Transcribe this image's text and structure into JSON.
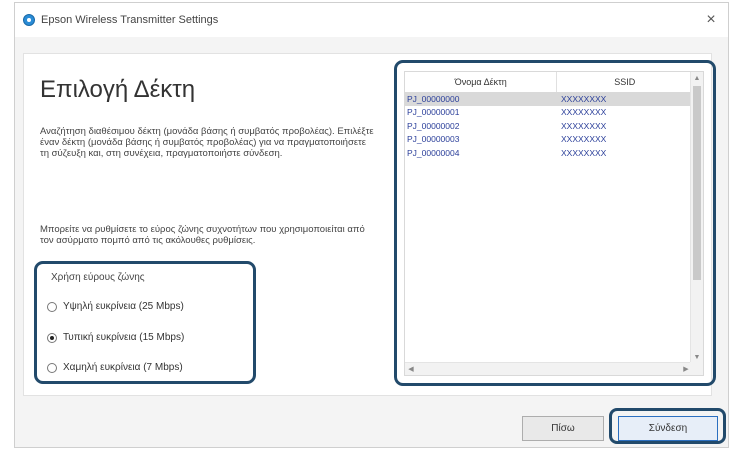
{
  "window": {
    "title": "Epson Wireless Transmitter Settings",
    "close_glyph": "×",
    "app_icon": "epson-app-icon"
  },
  "main": {
    "heading": "Επιλογή Δέκτη",
    "description_1": "Αναζήτηση διαθέσιμου δέκτη (μονάδα βάσης ή συμβατός προβολέας). Επιλέξτε έναν δέκτη (μονάδα βάσης ή συμβατός προβολέας) για να πραγματοποιήσετε τη σύζευξη και, στη συνέχεια, πραγματοποιήστε σύνδεση.",
    "description_2": "Μπορείτε να ρυθμίσετε το εύρος ζώνης συχνοτήτων που χρησιμοποιείται από τον ασύρματο πομπό από τις ακόλουθες ρυθμίσεις."
  },
  "bandwidth": {
    "label": "Χρήση εύρους ζώνης",
    "options": [
      {
        "label": "Υψηλή ευκρίνεια (25 Mbps)",
        "checked": false
      },
      {
        "label": "Τυπική ευκρίνεια (15 Mbps)",
        "checked": true
      },
      {
        "label": "Χαμηλή ευκρίνεια (7 Mbps)",
        "checked": false
      }
    ]
  },
  "receiver_list": {
    "columns": [
      "Όνομα Δέκτη",
      "SSID"
    ],
    "rows": [
      {
        "name": "PJ_00000000",
        "ssid": "XXXXXXXX",
        "selected": true
      },
      {
        "name": "PJ_00000001",
        "ssid": "XXXXXXXX",
        "selected": false
      },
      {
        "name": "PJ_00000002",
        "ssid": "XXXXXXXX",
        "selected": false
      },
      {
        "name": "PJ_00000003",
        "ssid": "XXXXXXXX",
        "selected": false
      },
      {
        "name": "PJ_00000004",
        "ssid": "XXXXXXXX",
        "selected": false
      }
    ],
    "scroll_arrows": {
      "up": "▲",
      "down": "▼",
      "left": "◀",
      "right": "▶"
    }
  },
  "buttons": {
    "back": "Πίσω",
    "connect": "Σύνδεση"
  },
  "colors": {
    "highlight_outline": "#224a6b",
    "list_text": "#2b3f9a",
    "selected_row": "#d9d9d9"
  }
}
